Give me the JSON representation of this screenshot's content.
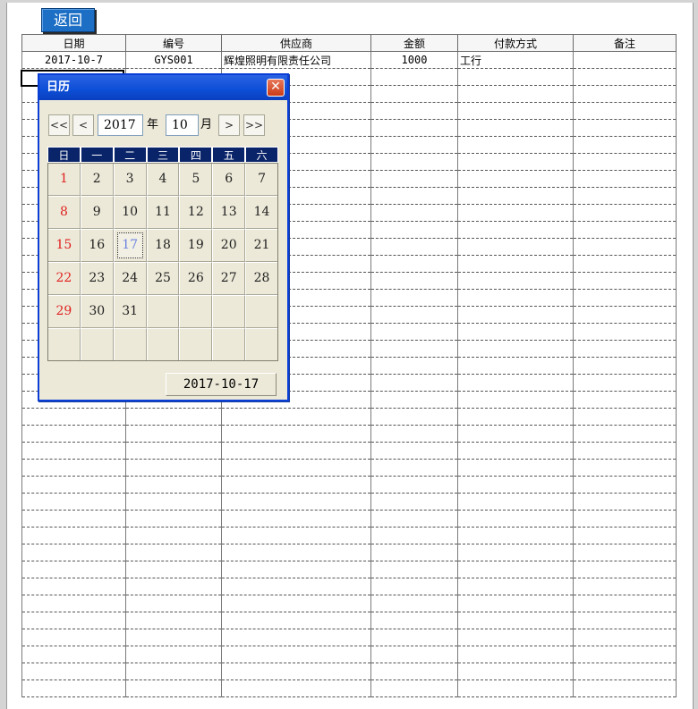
{
  "back_button": "返回",
  "table": {
    "columns": [
      "日期",
      "编号",
      "供应商",
      "金额",
      "付款方式",
      "备注"
    ],
    "rows": [
      [
        "2017-10-7",
        "GYS001",
        "辉煌照明有限责任公司",
        "1000",
        "工行",
        ""
      ]
    ]
  },
  "calendar": {
    "title": "日历",
    "close_glyph": "✕",
    "nav": {
      "first": "<<",
      "prev": "<",
      "next": ">",
      "last": ">>"
    },
    "year": "2017",
    "year_unit": "年",
    "month": "10",
    "month_unit": "月",
    "weekdays": [
      "日",
      "一",
      "二",
      "三",
      "四",
      "五",
      "六"
    ],
    "selected_day": "17",
    "first_weekday_index": 0,
    "days_in_month": 31,
    "today_label": "2017-10-17"
  },
  "colors": {
    "title_bar": "#0c4ed6",
    "weekday_header": "#0a246a",
    "sunday_text": "#e02020",
    "selected_text": "#1c3fd0",
    "back_button": "#1c6fc4"
  }
}
